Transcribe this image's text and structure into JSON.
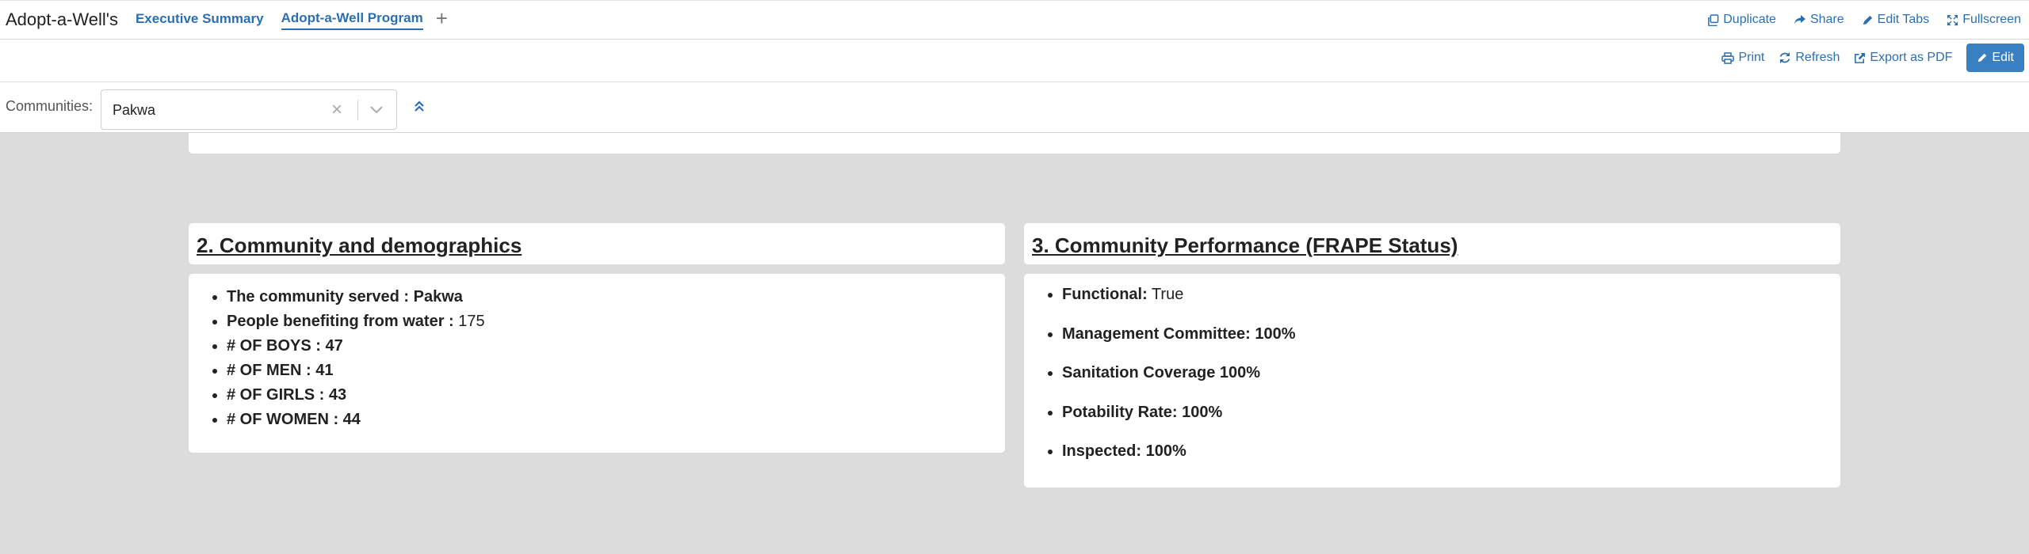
{
  "app": {
    "title": "Adopt-a-Well's"
  },
  "tabs": [
    {
      "label": "Executive Summary",
      "active": false
    },
    {
      "label": "Adopt-a-Well Program",
      "active": true
    }
  ],
  "top_actions": {
    "duplicate": "Duplicate",
    "share": "Share",
    "edit_tabs": "Edit Tabs",
    "fullscreen": "Fullscreen"
  },
  "action_bar": {
    "print": "Print",
    "refresh": "Refresh",
    "export_pdf": "Export as PDF",
    "edit": "Edit"
  },
  "filter": {
    "label": "Communities:",
    "value": "Pakwa"
  },
  "section2": {
    "title": "2. Community and demographics",
    "items": [
      {
        "label": "The community served : Pakwa",
        "value": ""
      },
      {
        "label": "People benefiting from water : ",
        "value": "175"
      },
      {
        "label": "# OF BOYS : 47",
        "value": ""
      },
      {
        "label": "# OF MEN : 41",
        "value": ""
      },
      {
        "label": "# OF GIRLS : 43",
        "value": ""
      },
      {
        "label": "# OF WOMEN : 44",
        "value": ""
      }
    ]
  },
  "section3": {
    "title": "3. Community Performance (FRAPE Status)",
    "items": [
      {
        "label": "Functional:",
        "value": " True"
      },
      {
        "label": "Management Committee: 100%",
        "value": ""
      },
      {
        "label": "Sanitation Coverage 100%",
        "value": ""
      },
      {
        "label": "Potability Rate: 100%",
        "value": ""
      },
      {
        "label": "Inspected: 100%",
        "value": ""
      }
    ]
  },
  "colors": {
    "accent": "#2a6fb0",
    "edit_button": "#3a7fc1",
    "background": "#dcdcdc"
  }
}
